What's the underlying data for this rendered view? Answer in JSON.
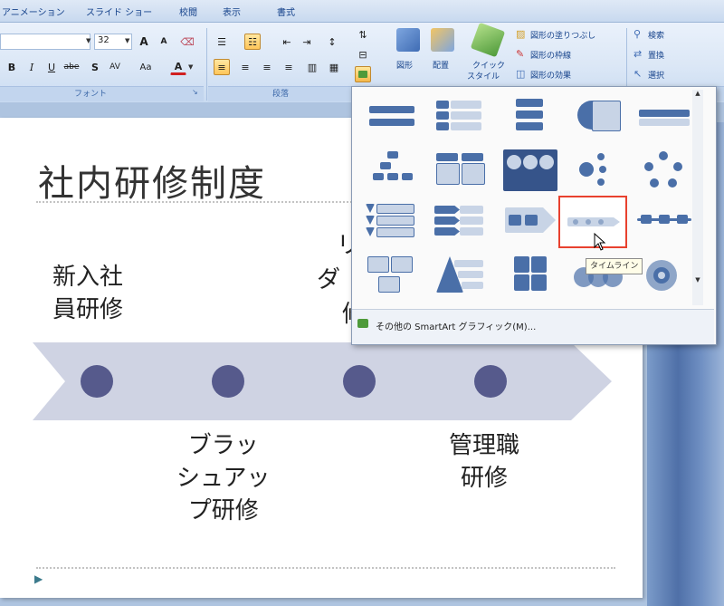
{
  "tabs": [
    "アニメーション",
    "スライド ショー",
    "校閲",
    "表示",
    "書式"
  ],
  "ribbon": {
    "font_size": "32",
    "font_group_label": "フォント",
    "paragraph_group_label": "段落",
    "shape_button": "図形",
    "arrange_button": "配置",
    "quick_style_line1": "クイック",
    "quick_style_line2": "スタイル",
    "shape_fill": "図形の塗りつぶし",
    "shape_outline": "図形の枠線",
    "shape_effects": "図形の効果",
    "find": "検索",
    "replace": "置換",
    "select": "選択",
    "fmt_bold": "B",
    "fmt_italic": "I",
    "fmt_underline": "U",
    "fmt_strike": "abe",
    "fmt_shadow": "S",
    "fmt_spacing": "AV",
    "fmt_case": "Aa",
    "fmt_color": "A",
    "grow_font": "A",
    "shrink_font": "A"
  },
  "slide": {
    "title": "社内研修制度",
    "labels_top": [
      {
        "lines": [
          "新入社",
          "員研修"
        ]
      },
      {
        "lines": [
          "リ",
          "ダ",
          "修"
        ]
      }
    ],
    "labels_bottom": [
      {
        "lines": [
          "ブラッ",
          "シュアッ",
          "プ研修"
        ]
      },
      {
        "lines": [
          "管理職",
          "研修"
        ]
      }
    ],
    "colors": {
      "arrow": "#cfd3e3",
      "dot": "#565a8c"
    }
  },
  "gallery": {
    "more_link": "その他の SmartArt グラフィック(M)...",
    "tooltip": "タイムライン",
    "highlight_color": "#e8412e"
  }
}
